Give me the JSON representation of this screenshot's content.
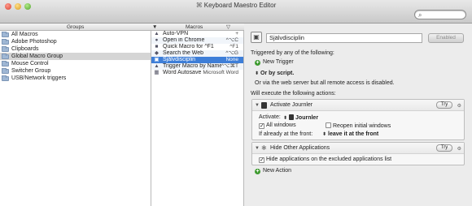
{
  "window": {
    "title": "Keyboard Maestro Editor"
  },
  "columns": {
    "groups": "Groups",
    "macros": "Macros"
  },
  "groups": [
    {
      "label": "All Macros",
      "selected": false
    },
    {
      "label": "Adobe Photoshop",
      "selected": false
    },
    {
      "label": "Clipboards",
      "selected": false
    },
    {
      "label": "Global Macro Group",
      "selected": true
    },
    {
      "label": "Mouse Control",
      "selected": false
    },
    {
      "label": "Switcher Group",
      "selected": false
    },
    {
      "label": "USB/Network triggers",
      "selected": false
    }
  ],
  "macros": [
    {
      "icon": "▲",
      "name": "Auto-VPN",
      "shortcut": "+"
    },
    {
      "icon": "●",
      "name": "Open in Chrome",
      "shortcut": "^⌥C"
    },
    {
      "icon": "■",
      "name": "Quick Macro for ^F1",
      "shortcut": "^F1"
    },
    {
      "icon": "◆",
      "name": "Search the Web",
      "shortcut": "^⌥G"
    },
    {
      "icon": "▣",
      "name": "Självdisciplin",
      "shortcut": "None"
    },
    {
      "icon": "▲",
      "name": "Trigger Macro by Name",
      "shortcut": "^⌥⌘T"
    },
    {
      "icon": "▦",
      "name": "Word Autosave",
      "shortcut": "Microsoft Word"
    }
  ],
  "editor": {
    "macro_name": "Självdisciplin",
    "enabled_label": "Enabled",
    "triggered_label": "Triggered by any of the following:",
    "new_trigger": "New Trigger",
    "or_by_script": "Or by script.",
    "web_server_text": "Or via the web server but all remote access is disabled.",
    "execute_label": "Will execute the following actions:",
    "new_action": "New Action",
    "actions": [
      {
        "title": "Activate Journler",
        "try": "Try",
        "activate_label": "Activate:",
        "app": "Journler",
        "all_windows": "All windows",
        "reopen": "Reopen initial windows",
        "front_label": "If already at the front:",
        "front_value": "leave it at the front"
      },
      {
        "title": "Hide Other Applications",
        "try": "Try",
        "hide_excluded": "Hide applications on the excluded applications list"
      }
    ]
  }
}
